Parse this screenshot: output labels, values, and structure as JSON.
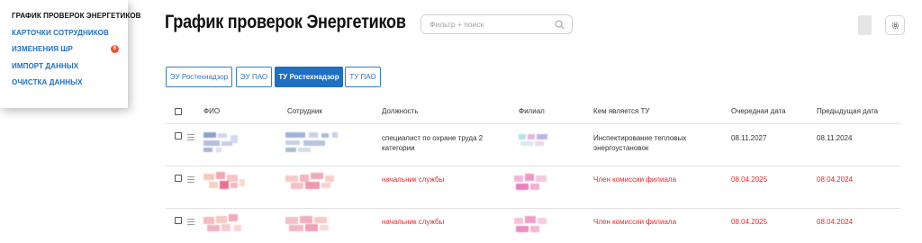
{
  "menu": {
    "items": [
      {
        "label": "ГРАФИК ПРОВЕРОК ЭНЕРГЕТИКОВ",
        "active": true
      },
      {
        "label": "КАРТОЧКИ СОТРУДНИКОВ",
        "active": false
      },
      {
        "label": "ИЗМЕНЕНИЯ ШР",
        "active": false,
        "badge": "6"
      },
      {
        "label": "ИМПОРТ ДАННЫХ",
        "active": false
      },
      {
        "label": "ОЧИСТКА ДАННЫХ",
        "active": false
      }
    ]
  },
  "header": {
    "title": "График проверок Энергетиков",
    "search_placeholder": "Фильтр + поиск"
  },
  "tabs": [
    {
      "label": "ЭУ Ростехнадзор",
      "active": false
    },
    {
      "label": "ЭУ ПАО",
      "active": false
    },
    {
      "label": "ТУ Ростехнадзор",
      "active": true
    },
    {
      "label": "ТУ ПАО",
      "active": false
    }
  ],
  "table": {
    "columns": [
      "ФИО",
      "Сотрудник",
      "Должность",
      "Филиал",
      "Кем является ТУ",
      "Очередная дата",
      "Предыдущая дата"
    ],
    "rows": [
      {
        "position_line1": "специалист по охране труда 2",
        "position_line2": "категории",
        "role_line1": "Инспектирование тепловых",
        "role_line2": "энергоустановок",
        "next_date": "08.11.2027",
        "prev_date": "08.11.2024",
        "alert": false
      },
      {
        "position_line1": "начальник службы",
        "position_line2": "",
        "role_line1": "Член комиссии филиала",
        "role_line2": "",
        "next_date": "08.04.2025",
        "prev_date": "08.04.2024",
        "alert": true
      },
      {
        "position_line1": "начальник службы",
        "position_line2": "",
        "role_line1": "Член комиссии филиала",
        "role_line2": "",
        "next_date": "08.04.2025",
        "prev_date": "08.04.2024",
        "alert": true
      }
    ]
  },
  "colors": {
    "accent": "#1f6fc2",
    "alert": "#e8262a",
    "badge": "#e8562f"
  }
}
